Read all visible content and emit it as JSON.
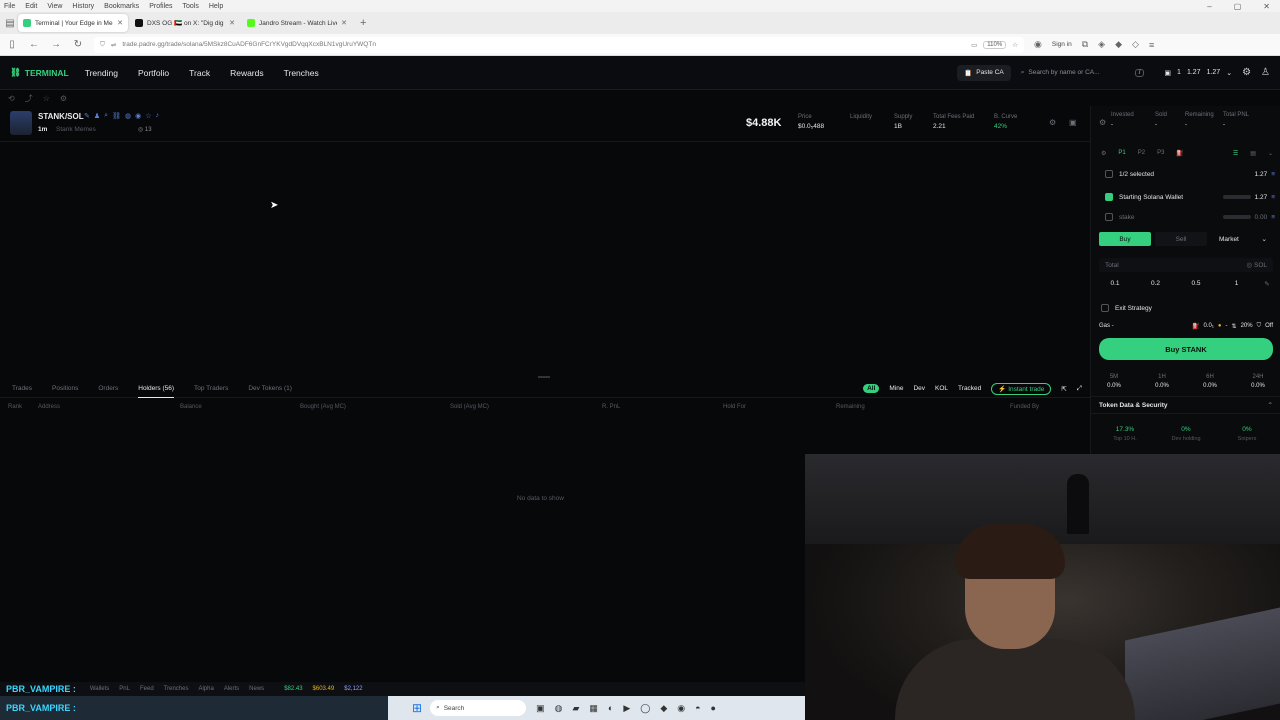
{
  "browser": {
    "menu": [
      "File",
      "Edit",
      "View",
      "History",
      "Bookmarks",
      "Profiles",
      "Tools",
      "Help"
    ],
    "tabs": [
      {
        "title": "Terminal | Your Edge in Me",
        "color": "#35d07f",
        "active": true
      },
      {
        "title": "DXS OG 🇦🇪 on X: \"Dig dig cat is",
        "color": "#111111",
        "active": false
      },
      {
        "title": "Jandro Stream - Watch Live on",
        "color": "#53fc18",
        "active": false
      }
    ],
    "url": "trade.padre.gg/trade/solana/5MSkz8CuADF6GnFCrYKVgdDVqqXcxBLN1vgUruYWQTn",
    "zoom": "110%",
    "signin": "Sign in"
  },
  "app": {
    "logo": "TERMINAL",
    "nav": [
      "Trending",
      "Portfolio",
      "Track",
      "Rewards",
      "Trenches"
    ],
    "paste_ca": "Paste CA",
    "search_placeholder": "Search by name or CA...",
    "slash": "/",
    "wallet_count": "1",
    "balance1": "1.27",
    "balance2": "1.27"
  },
  "token": {
    "pair": "STANK/SOL",
    "age": "1m",
    "name": "Stank Memes",
    "holders": "13",
    "mcap": "$4.88K",
    "stats": [
      {
        "label": "Price",
        "value": "$0.0₅488"
      },
      {
        "label": "Liquidity",
        "value": ""
      },
      {
        "label": "Supply",
        "value": "1B"
      },
      {
        "label": "Total Fees Paid",
        "value": "2.21"
      },
      {
        "label": "B. Curve",
        "value": "42%"
      }
    ]
  },
  "bottom": {
    "tabs": [
      "Trades",
      "Positions",
      "Orders",
      "Holders (56)",
      "Top Traders",
      "Dev Tokens (1)"
    ],
    "filters": [
      "All",
      "Mine",
      "Dev",
      "KOL",
      "Tracked"
    ],
    "instant": "Instant trade",
    "columns": [
      "Rank",
      "Address",
      "Balance",
      "Bought (Avg MC)",
      "Sold (Avg MC)",
      "R. PnL",
      "Hold For",
      "Remaining",
      "Funded By"
    ],
    "empty": "No data to show"
  },
  "panel": {
    "stats": [
      {
        "label": "Invested",
        "value": "-"
      },
      {
        "label": "Sold",
        "value": "-"
      },
      {
        "label": "Remaining",
        "value": "-"
      },
      {
        "label": "Total PNL",
        "value": "-"
      }
    ],
    "presets": [
      "P1",
      "P2",
      "P3"
    ],
    "selected": "1/2 selected",
    "selected_value": "1.27",
    "wallets": [
      {
        "name": "Starting Solana Wallet",
        "value": "1.27",
        "checked": true
      },
      {
        "name": "stake",
        "value": "0.00",
        "checked": false
      }
    ],
    "buy": "Buy",
    "sell": "Sell",
    "order_type": "Market",
    "total_label": "Total",
    "total_unit": "SOL",
    "amounts": [
      "0.1",
      "0.2",
      "0.5",
      "1"
    ],
    "exit_strategy": "Exit Strategy",
    "gas_label": "Gas -",
    "gas_fee": "0.0₁",
    "gas_slip": "20%",
    "gas_mev": "Off",
    "buy_button": "Buy STANK",
    "timeframes": [
      {
        "label": "5M",
        "value": "0.0%"
      },
      {
        "label": "1H",
        "value": "0.0%"
      },
      {
        "label": "6H",
        "value": "0.0%"
      },
      {
        "label": "24H",
        "value": "0.0%"
      }
    ],
    "security_title": "Token Data & Security",
    "security": [
      {
        "value": "17.3%",
        "label": "Top 10 H."
      },
      {
        "value": "0%",
        "label": "Dev holding"
      },
      {
        "value": "0%",
        "label": "Snipers"
      }
    ]
  },
  "stream": {
    "streamer": "PBR_VAMPIRE :",
    "items": [
      "Wallets",
      "PnL",
      "Feed",
      "Trenches",
      "Alpha",
      "Alerts",
      "News"
    ],
    "prices": [
      "$82.43",
      "$603.49",
      "$2,122"
    ]
  },
  "taskbar": {
    "search": "Search"
  }
}
